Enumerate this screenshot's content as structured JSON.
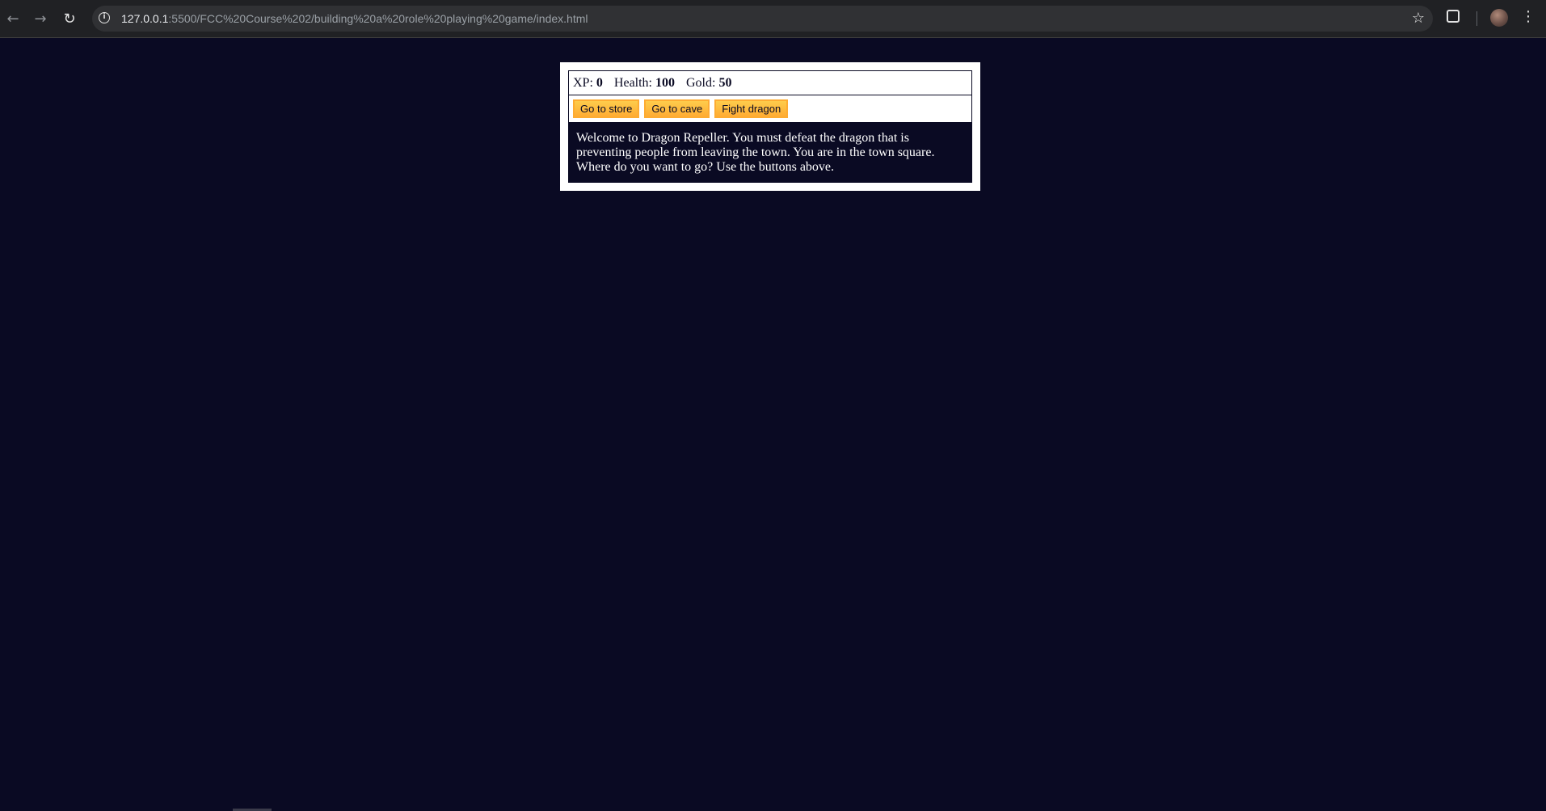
{
  "browser": {
    "url_host": "127.0.0.1",
    "url_rest": ":5500/FCC%20Course%202/building%20a%20role%20playing%20game/index.html"
  },
  "game": {
    "stats": {
      "xp_label": "XP: ",
      "xp_value": "0",
      "health_label": "Health: ",
      "health_value": "100",
      "gold_label": "Gold: ",
      "gold_value": "50"
    },
    "buttons": {
      "store": "Go to store",
      "cave": "Go to cave",
      "dragon": "Fight dragon"
    },
    "text": "Welcome to Dragon Repeller. You must defeat the dragon that is preventing people from leaving the town. You are in the town square. Where do you want to go? Use the buttons above."
  },
  "icons": {
    "back": "back-arrow-icon",
    "forward": "forward-arrow-icon",
    "reload": "reload-icon",
    "info": "info-icon",
    "star": "star-icon",
    "extensions": "extensions-icon",
    "profile": "avatar",
    "menu": "kebab-menu-icon"
  },
  "colors": {
    "page_background": "#0a0a23",
    "button": "#feac32",
    "game_container": "#ffffff"
  }
}
